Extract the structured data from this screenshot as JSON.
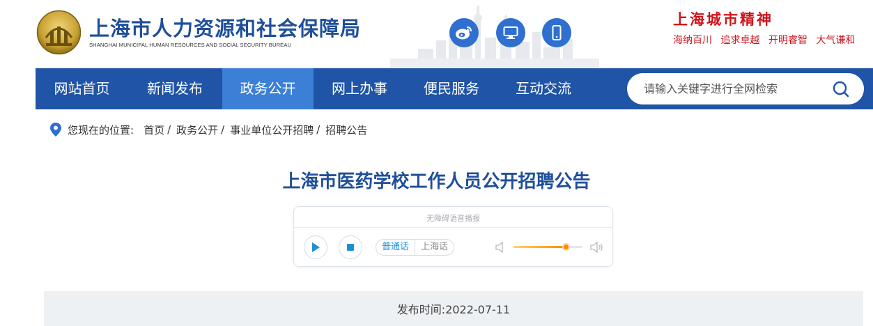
{
  "header": {
    "site_title": "上海市人力资源和社会保障局",
    "site_subtitle": "SHANGHAI MUNICIPAL HUMAN RESOURCES AND SOCIAL SECURITY BUREAU",
    "icons": [
      "weibo-icon",
      "desktop-icon",
      "mobile-icon"
    ],
    "spirit_title": "上海城市精神",
    "spirit_phrases": [
      "海纳百川",
      "追求卓越",
      "开明睿智",
      "大气谦和"
    ]
  },
  "nav": {
    "items": [
      {
        "label": "网站首页",
        "active": false
      },
      {
        "label": "新闻发布",
        "active": false
      },
      {
        "label": "政务公开",
        "active": true
      },
      {
        "label": "网上办事",
        "active": false
      },
      {
        "label": "便民服务",
        "active": false
      },
      {
        "label": "互动交流",
        "active": false
      }
    ],
    "search": {
      "placeholder": "请输入关键字进行全网检索",
      "value": ""
    }
  },
  "breadcrumb": {
    "label": "您现在的位置:",
    "items": [
      "首页",
      "政务公开",
      "事业单位公开招聘",
      "招聘公告"
    ]
  },
  "article": {
    "title": "上海市医药学校工作人员公开招聘公告"
  },
  "player": {
    "caption": "无障碍语音播报",
    "languages": [
      {
        "label": "普通话",
        "active": true
      },
      {
        "label": "上海话",
        "active": false
      }
    ],
    "volume": 0.76
  },
  "publish": {
    "text": "发布时间:2022-07-11"
  },
  "colors": {
    "brand_blue": "#2054a6",
    "nav_active": "#3b7fd6",
    "title_blue": "#1f4f9a",
    "spirit_red": "#d0121b",
    "volume_orange": "#ff8a00"
  }
}
